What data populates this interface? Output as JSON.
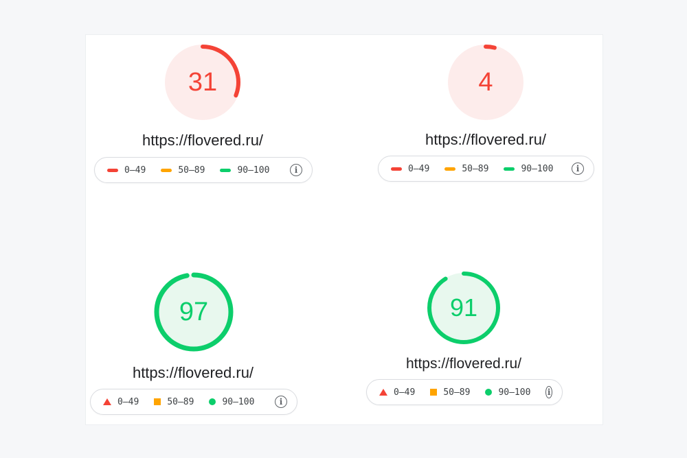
{
  "colors": {
    "fail": "#f44336",
    "fail_bg": "#fdeceb",
    "average": "#ffa400",
    "pass": "#0cce6b",
    "pass_bg": "#e8f8ee"
  },
  "reports": [
    {
      "score": 31,
      "score_text": "31",
      "url": "https://flovered.ru/",
      "legend": [
        {
          "label": "0–49",
          "shape": "bar",
          "color": "#f44336"
        },
        {
          "label": "50–89",
          "shape": "bar",
          "color": "#ffa400"
        },
        {
          "label": "90–100",
          "shape": "bar",
          "color": "#0cce6b"
        }
      ],
      "info_icon": "info-icon"
    },
    {
      "score": 4,
      "score_text": "4",
      "url": "https://flovered.ru/",
      "legend": [
        {
          "label": "0–49",
          "shape": "bar",
          "color": "#f44336"
        },
        {
          "label": "50–89",
          "shape": "bar",
          "color": "#ffa400"
        },
        {
          "label": "90–100",
          "shape": "bar",
          "color": "#0cce6b"
        }
      ],
      "info_icon": "info-icon"
    },
    {
      "score": 97,
      "score_text": "97",
      "url": "https://flovered.ru/",
      "legend": [
        {
          "label": "0–49",
          "shape": "triangle",
          "color": "#f44336"
        },
        {
          "label": "50–89",
          "shape": "square",
          "color": "#ffa400"
        },
        {
          "label": "90–100",
          "shape": "dot",
          "color": "#0cce6b"
        }
      ],
      "info_icon": "info-icon"
    },
    {
      "score": 91,
      "score_text": "91",
      "url": "https://flovered.ru/",
      "legend": [
        {
          "label": "0–49",
          "shape": "triangle",
          "color": "#f44336"
        },
        {
          "label": "50–89",
          "shape": "square",
          "color": "#ffa400"
        },
        {
          "label": "90–100",
          "shape": "dot",
          "color": "#0cce6b"
        }
      ],
      "info_icon": "info-icon"
    }
  ]
}
